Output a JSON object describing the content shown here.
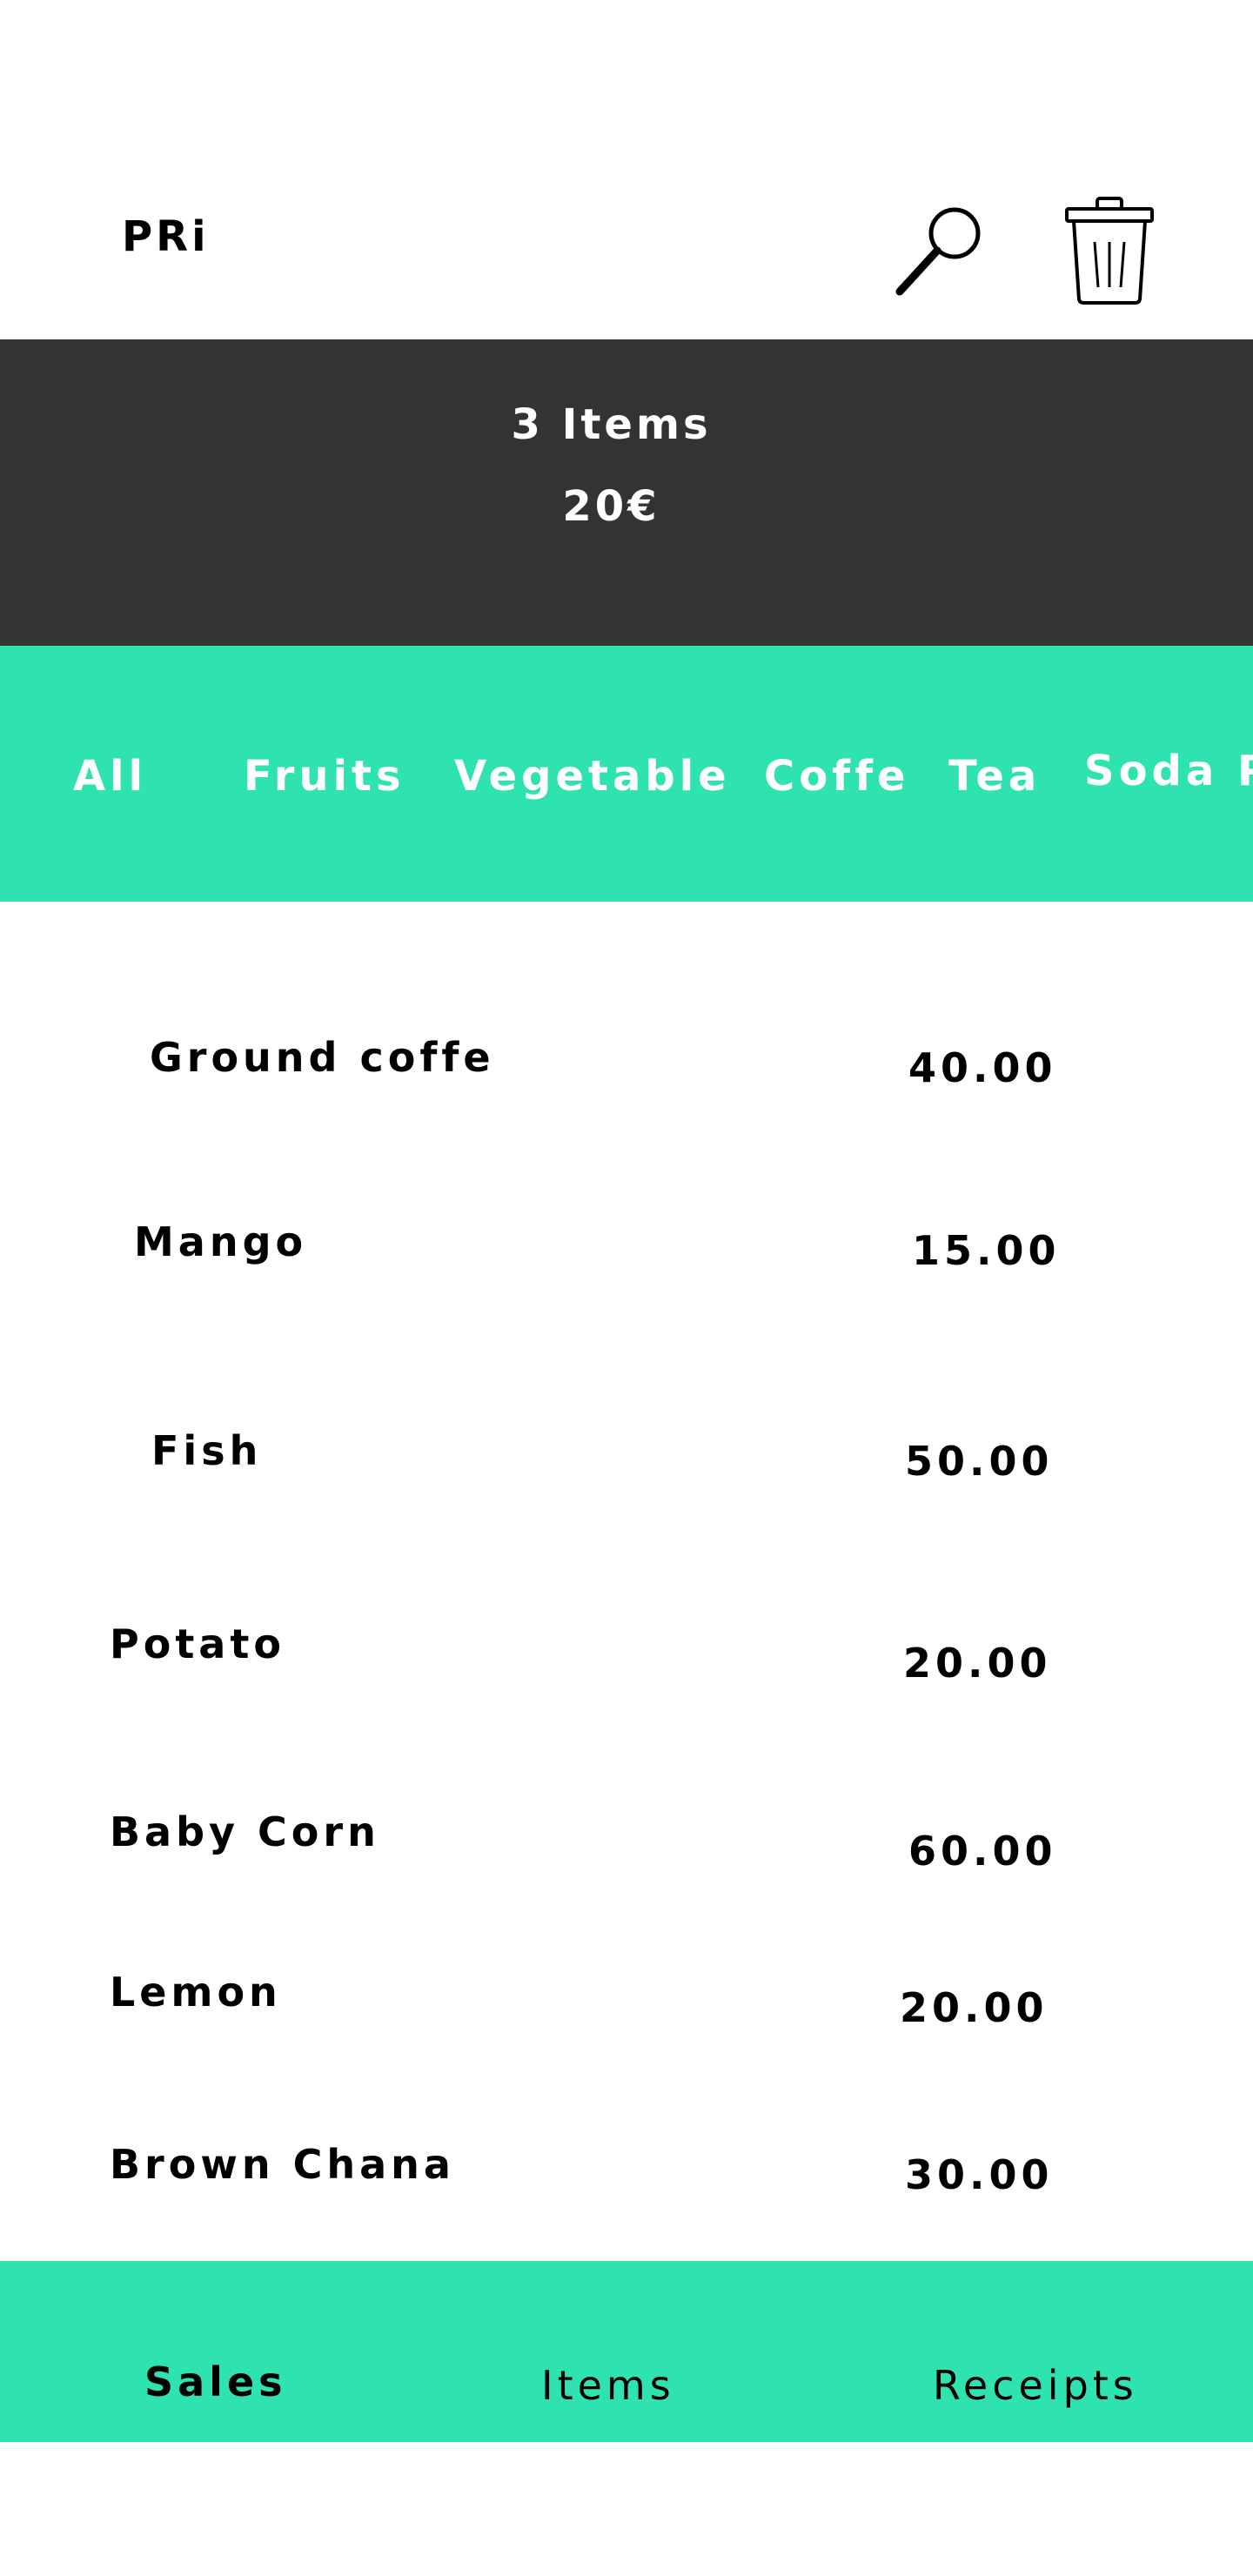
{
  "header": {
    "brand": "PRi",
    "search_icon": "search-icon",
    "delete_icon": "trash-icon"
  },
  "summary": {
    "item_count": "3 Items",
    "total": "20€"
  },
  "categories": [
    "All",
    "Fruits",
    "Vegetable",
    "Coffe",
    "Tea",
    "Soda P"
  ],
  "products": [
    {
      "name": "Ground coffe",
      "price": "40.00"
    },
    {
      "name": "Mango",
      "price": "15.00"
    },
    {
      "name": "Fish",
      "price": "50.00"
    },
    {
      "name": "Potato",
      "price": "20.00"
    },
    {
      "name": "Baby Corn",
      "price": "60.00"
    },
    {
      "name": "Lemon",
      "price": "20.00"
    },
    {
      "name": "Brown Chana",
      "price": "30.00"
    }
  ],
  "bottom_nav": {
    "sales": "Sales",
    "items": "Items",
    "receipts": "Receipts"
  },
  "colors": {
    "accent": "#2fe3b0",
    "summary_bg": "#333333",
    "text": "#000000"
  }
}
